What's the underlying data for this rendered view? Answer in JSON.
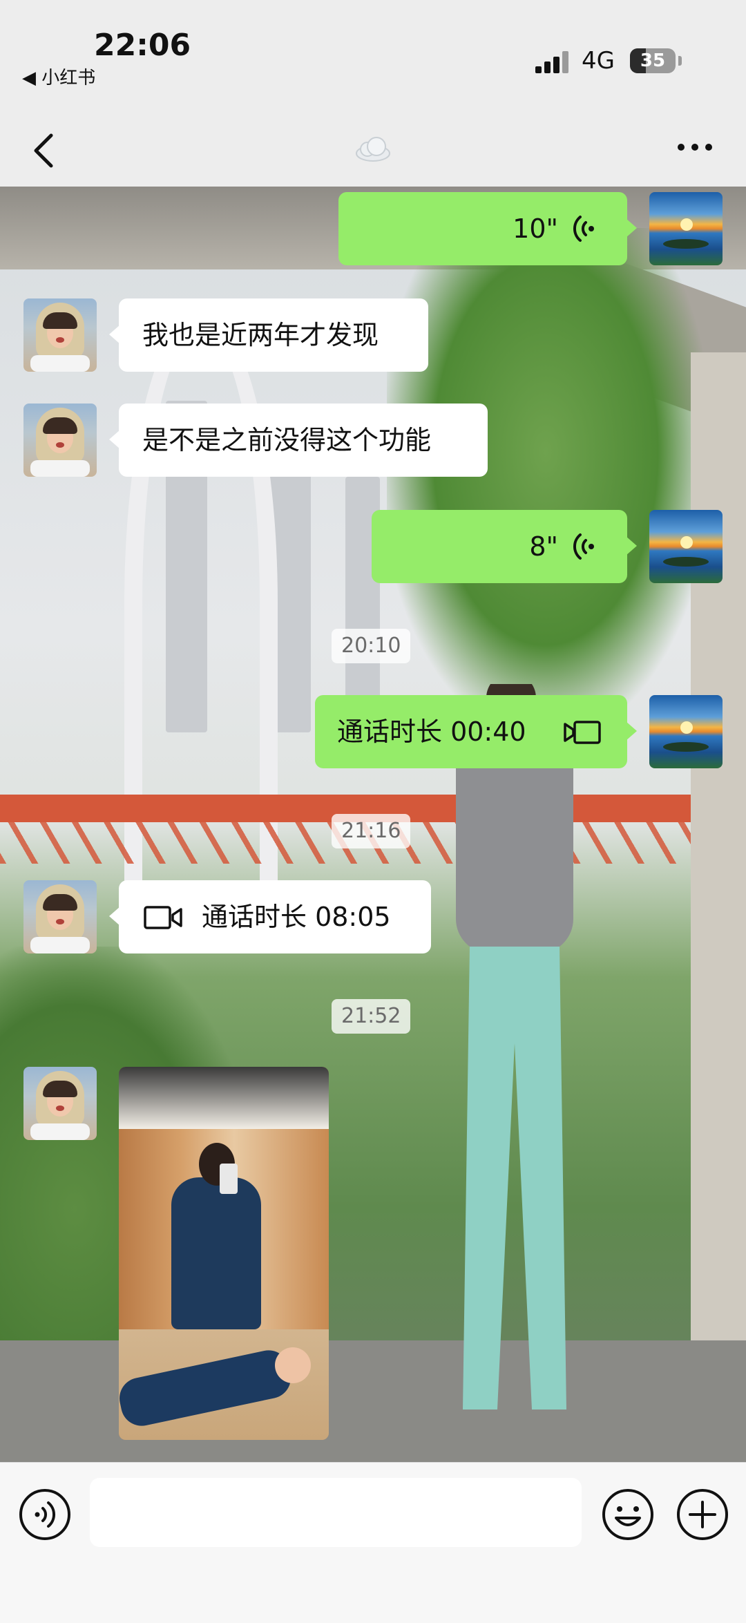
{
  "status_bar": {
    "time": "22:06",
    "back_app": "◀ 小红书",
    "network": "4G",
    "battery": "35",
    "battery_level_percent": 35
  },
  "nav": {
    "back_icon": "chevron-left-icon",
    "title_icon": "cloud-icon",
    "more_icon": "more-dots-icon"
  },
  "colors": {
    "outgoing_bubble": "#95ec69",
    "incoming_bubble": "#ffffff",
    "timestamp_text": "#6a6a6a",
    "background": "#ededed"
  },
  "messages": [
    {
      "id": "m1",
      "direction": "out",
      "type": "voice",
      "duration": "10\""
    },
    {
      "id": "m2",
      "direction": "in",
      "type": "text",
      "text": "我也是近两年才发现"
    },
    {
      "id": "m3",
      "direction": "in",
      "type": "text",
      "text": "是不是之前没得这个功能"
    },
    {
      "id": "m4",
      "direction": "out",
      "type": "voice",
      "duration": "8\""
    },
    {
      "id": "t1",
      "type": "timestamp",
      "text": "20:10"
    },
    {
      "id": "m5",
      "direction": "out",
      "type": "call",
      "text": "通话时长 00:40",
      "icon": "video-call-icon"
    },
    {
      "id": "t2",
      "type": "timestamp",
      "text": "21:16"
    },
    {
      "id": "m6",
      "direction": "in",
      "type": "call",
      "text": "通话时长 08:05",
      "icon": "video-call-icon"
    },
    {
      "id": "t3",
      "type": "timestamp",
      "text": "21:52"
    },
    {
      "id": "m7",
      "direction": "in",
      "type": "image",
      "image": "mirror-selfie-photo"
    }
  ],
  "input_bar": {
    "voice_icon": "voice-input-icon",
    "emoji_icon": "emoji-icon",
    "plus_icon": "plus-icon",
    "placeholder": ""
  }
}
